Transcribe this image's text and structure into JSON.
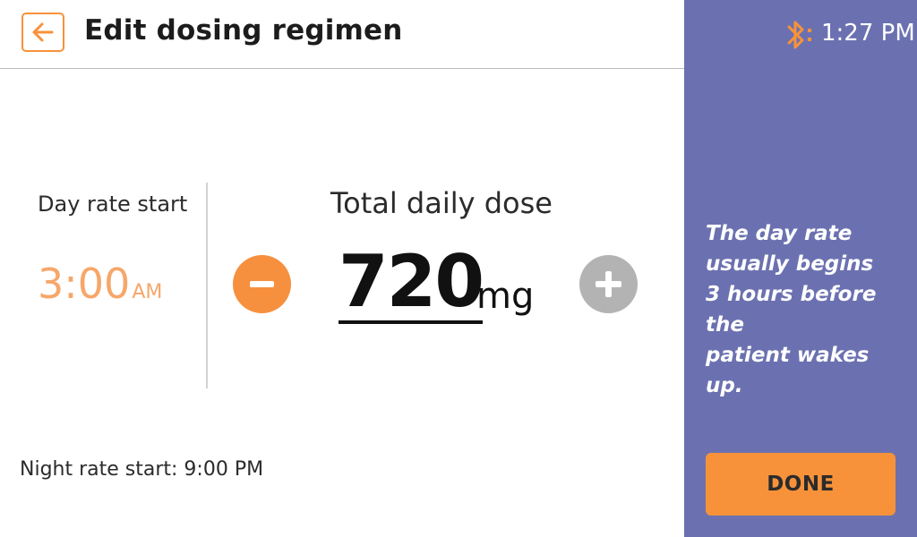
{
  "header": {
    "title": "Edit dosing regimen",
    "back_icon": "arrow-left-icon"
  },
  "status": {
    "bluetooth_icon": "bluetooth-icon",
    "time": "1:27 PM"
  },
  "day_rate": {
    "label": "Day rate start",
    "time": "3:00",
    "ampm": "AM"
  },
  "dose": {
    "title": "Total daily dose",
    "value": "720",
    "unit": "mg",
    "decrease_icon": "minus-icon",
    "increase_icon": "plus-icon"
  },
  "night_rate": {
    "text": "Night rate start: 9:00 PM"
  },
  "panel": {
    "hint_lines": [
      "The day rate",
      "usually begins",
      "3 hours before the",
      "patient wakes up."
    ],
    "done_label": "DONE"
  },
  "colors": {
    "accent": "#f7923a",
    "panel": "#6b71b0",
    "disabled": "#b3b3b3",
    "time_value": "#f6a76a"
  }
}
